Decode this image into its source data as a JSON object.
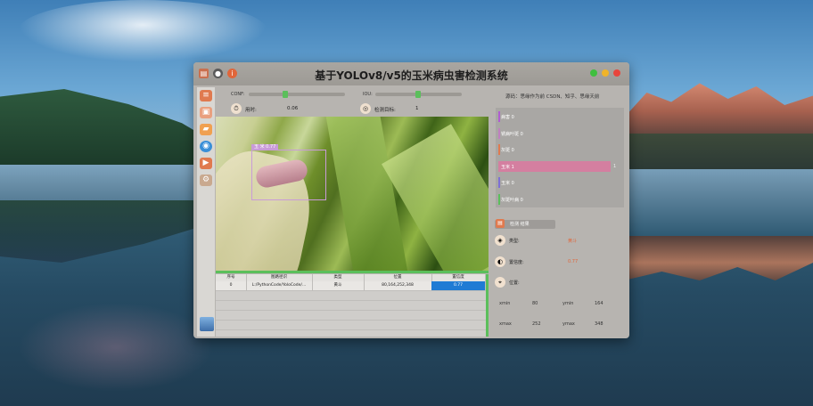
{
  "window": {
    "title": "基于YOLOv8/v5的玉米病虫害检测系统"
  },
  "sliders": {
    "conf_label": "CONF:",
    "conf_value": 0.2,
    "iou_label": "IOU:",
    "iou_value": 0.5
  },
  "stats": {
    "time_label": "用时:",
    "time_value": "0.06",
    "targets_label": "检测目标:",
    "targets_value": "1"
  },
  "source_text": "源码：思缘作为前 CSDN、知乎、思缘天前",
  "detection": {
    "tag": "玉 米 0.77"
  },
  "table": {
    "headers": [
      "序号",
      "图路径识",
      "类型",
      "位置",
      "置信度"
    ],
    "rows": [
      [
        "0",
        "L:/PythonCode/YoloCode/...",
        "黄斗",
        "80,164,252,348",
        "0.77"
      ]
    ]
  },
  "chart_data": {
    "type": "bar",
    "categories": [
      "病害 0",
      "锈病叶斑 0",
      "灰斑 0",
      "玉米 1",
      "玉米 0",
      "灰斑叶病 0"
    ],
    "values": [
      0,
      0,
      0,
      1,
      0,
      0
    ],
    "highlight_color": "#d47fa0",
    "bar_colors": [
      "#b05dd1",
      "#c07fc0",
      "#e07a4f",
      "#d47fa0",
      "#7d6fd6",
      "#5bbf5b"
    ]
  },
  "result": {
    "title": "检测 结果",
    "type_label": "类型:",
    "type_value": "黄斗",
    "conf_label": "置信度:",
    "conf_value": "0.77",
    "pos_label": "位置:",
    "xmin_label": "xmin",
    "xmin": "80",
    "ymin_label": "ymin",
    "ymin": "164",
    "xmax_label": "xmax",
    "xmax": "252",
    "ymax_label": "ymax",
    "ymax": "348"
  }
}
